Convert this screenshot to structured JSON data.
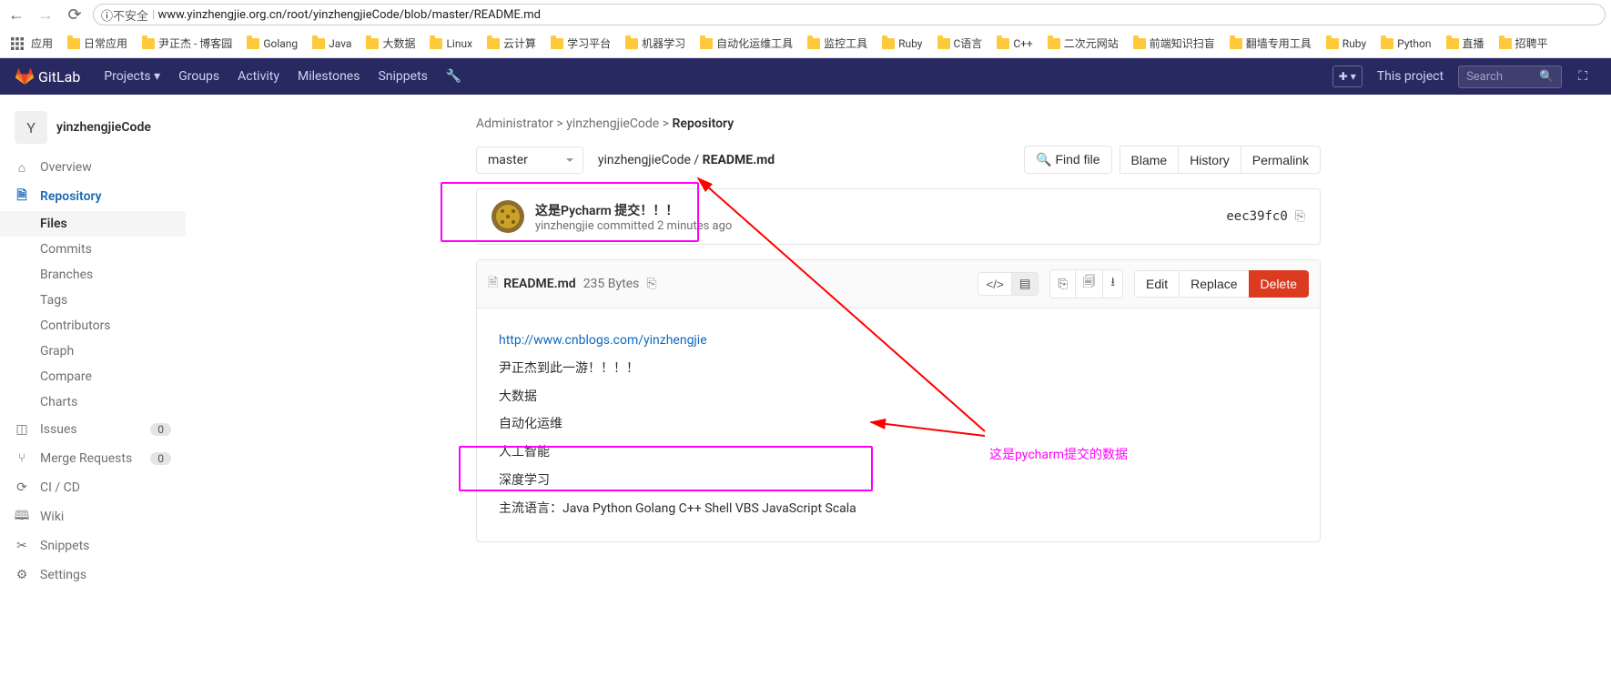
{
  "browser": {
    "insecure_label": "不安全",
    "url": "www.yinzhengjie.org.cn/root/yinzhengjieCode/blob/master/README.md"
  },
  "bookmarks": {
    "apps": "应用",
    "items": [
      "日常应用",
      "尹正杰 - 博客园",
      "Golang",
      "Java",
      "大数据",
      "Linux",
      "云计算",
      "学习平台",
      "机器学习",
      "自动化运维工具",
      "监控工具",
      "Ruby",
      "C语言",
      "C++",
      "二次元网站",
      "前端知识扫盲",
      "翻墙专用工具",
      "Ruby",
      "Python",
      "直播",
      "招聘平"
    ]
  },
  "nav": {
    "brand": "GitLab",
    "items": [
      "Projects",
      "Groups",
      "Activity",
      "Milestones",
      "Snippets"
    ],
    "this_project": "This project",
    "search_placeholder": "Search"
  },
  "sidebar": {
    "project_letter": "Y",
    "project_name": "yinzhengjieCode",
    "overview": "Overview",
    "repository": "Repository",
    "sub": [
      "Files",
      "Commits",
      "Branches",
      "Tags",
      "Contributors",
      "Graph",
      "Compare",
      "Charts"
    ],
    "issues": "Issues",
    "issues_count": "0",
    "merge": "Merge Requests",
    "merge_count": "0",
    "cicd": "CI / CD",
    "wiki": "Wiki",
    "snippets": "Snippets",
    "settings": "Settings"
  },
  "breadcrumb": {
    "owner": "Administrator",
    "project": "yinzhengjieCode",
    "repo": "Repository"
  },
  "filebar": {
    "branch": "master",
    "path_project": "yinzhengjieCode",
    "path_file": "README.md",
    "find_file": "Find file",
    "blame": "Blame",
    "history": "History",
    "permalink": "Permalink"
  },
  "commit": {
    "title": "这是Pycharm 提交！！！",
    "author": "yinzhengjie",
    "action": "committed",
    "when": "2 minutes ago",
    "sha": "eec39fc0"
  },
  "file": {
    "name": "README.md",
    "size": "235 Bytes",
    "edit": "Edit",
    "replace": "Replace",
    "delete": "Delete"
  },
  "content": {
    "link": "http://www.cnblogs.com/yinzhengjie",
    "l1": "尹正杰到此一游！！！！",
    "l2": "大数据",
    "l3": "自动化运维",
    "l4": "人工智能",
    "l5": "深度学习",
    "l6": "主流语言：Java Python Golang C++ Shell VBS JavaScript Scala"
  },
  "annotation": "这是pycharm提交的数据"
}
